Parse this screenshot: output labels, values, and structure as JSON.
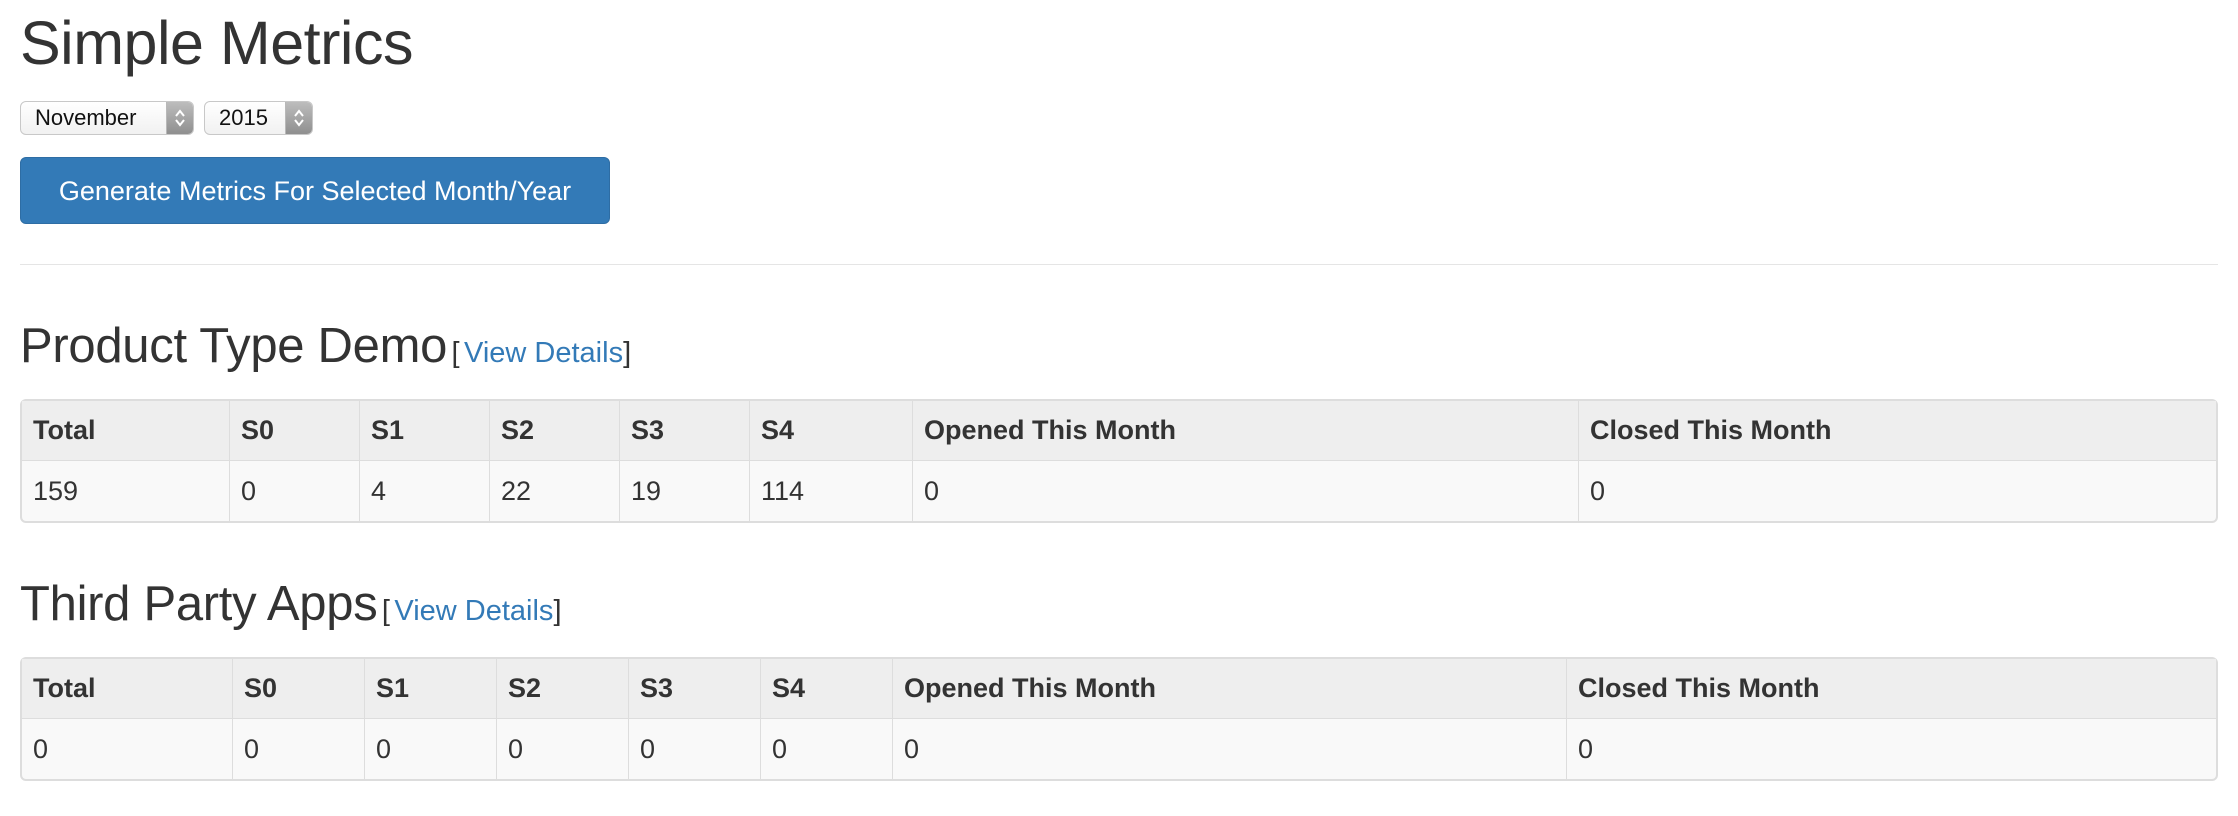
{
  "page": {
    "title": "Simple Metrics"
  },
  "filters": {
    "month": {
      "selected": "November"
    },
    "year": {
      "selected": "2015"
    },
    "generate_label": "Generate Metrics For Selected Month/Year"
  },
  "columns": [
    "Total",
    "S0",
    "S1",
    "S2",
    "S3",
    "S4",
    "Opened This Month",
    "Closed This Month"
  ],
  "sections": [
    {
      "name": "Product Type Demo",
      "bracket_open": "[",
      "bracket_close": "]",
      "link_label": "View Details",
      "row": [
        "159",
        "0",
        "4",
        "22",
        "19",
        "114",
        "0",
        "0"
      ]
    },
    {
      "name": "Third Party Apps",
      "bracket_open": "[",
      "bracket_close": "]",
      "link_label": "View Details",
      "row": [
        "0",
        "0",
        "0",
        "0",
        "0",
        "0",
        "0",
        "0"
      ]
    }
  ],
  "icons": {
    "stepper": "up-down-arrows-icon"
  },
  "colors": {
    "primary": "#337ab7",
    "text": "#333333"
  }
}
